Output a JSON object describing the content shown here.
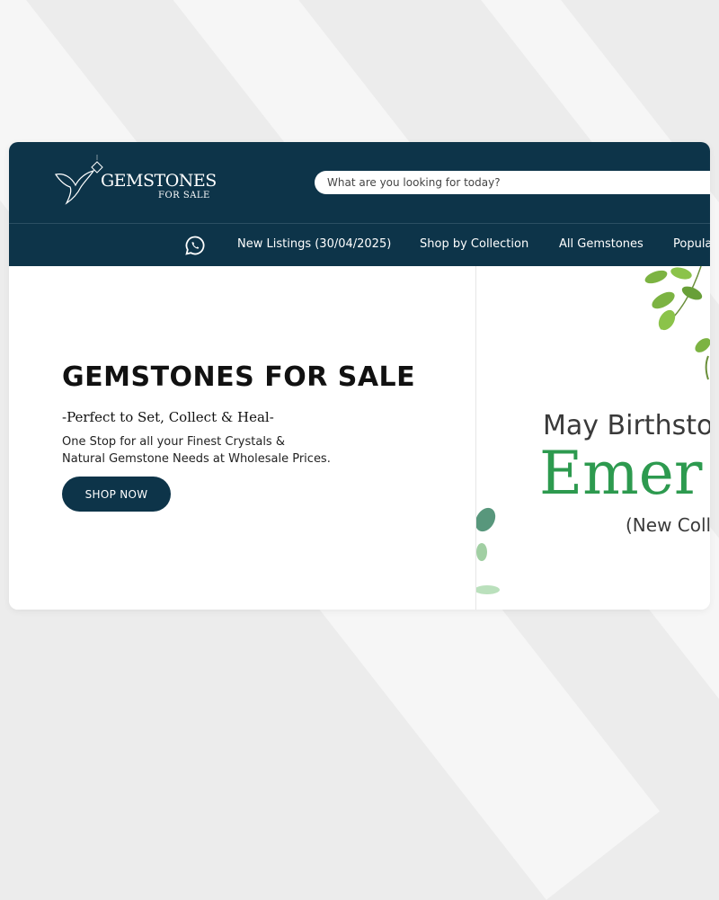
{
  "header": {
    "logo_title": "GEMSTONES",
    "logo_subtitle": "FOR SALE",
    "search_placeholder": "What are you looking for today?"
  },
  "nav": {
    "icon": "whatsapp-icon",
    "items": [
      {
        "label": "New Listings (30/04/2025)"
      },
      {
        "label": "Shop by Collection"
      },
      {
        "label": "All Gemstones"
      },
      {
        "label": "Popula"
      }
    ]
  },
  "hero": {
    "title": "GEMSTONES FOR SALE",
    "tagline": "-Perfect to Set, Collect & Heal-",
    "description_line1": "One Stop for all your Finest Crystals &",
    "description_line2": "Natural Gemstone Needs at Wholesale Prices.",
    "button_label": "SHOP NOW"
  },
  "banner": {
    "line1": "May Birthsto",
    "big_text": "Emer",
    "subtitle": "(New Coll"
  },
  "colors": {
    "brand_navy": "#0d3449",
    "banner_green": "#2d9a4f",
    "leaf_green": "#7cb342"
  }
}
